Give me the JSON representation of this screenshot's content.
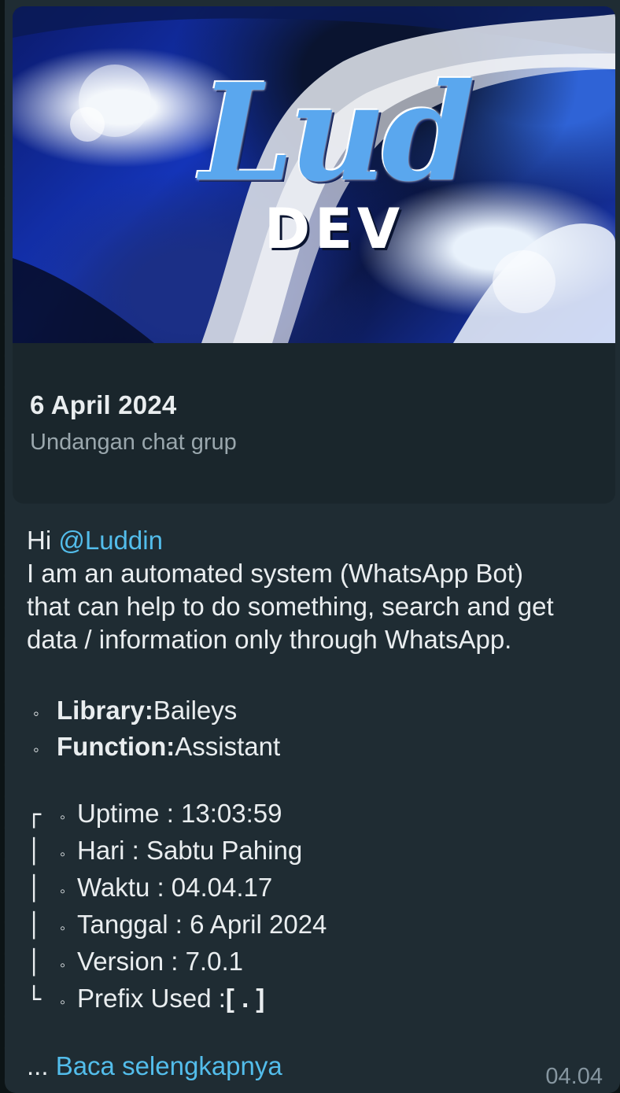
{
  "card": {
    "banner_text_main": "Lud",
    "banner_text_sub": "DEV",
    "title": "6 April 2024",
    "subtitle": "Undangan chat grup"
  },
  "message": {
    "greeting": "Hi ",
    "mention": "@Luddin",
    "intro_line1": "I am an automated system (WhatsApp Bot)",
    "intro_line2": "that can help to do something, search and get",
    "intro_line3": "data / information only through WhatsApp.",
    "bullets": [
      {
        "label": "Library:",
        "value": " Baileys"
      },
      {
        "label": "Function:",
        "value": " Assistant"
      }
    ],
    "frame_chars": [
      "┌",
      "│",
      "│",
      "│",
      "│",
      "└"
    ],
    "stats": [
      "Uptime : 13:03:59",
      "Hari : Sabtu Pahing",
      "Waktu : 04.04.17",
      "Tanggal : 6 April 2024",
      "Version : 7.0.1",
      "Prefix Used : "
    ],
    "prefix_value": "[ . ]",
    "ellipsis": "... ",
    "read_more": "Baca selengkapnya",
    "time": "04.04"
  },
  "icons": {
    "bullet": "white-circle-bullet"
  },
  "colors": {
    "bubble": "#1f2c33",
    "card": "#1a262c",
    "link": "#53bdeb",
    "secondary_text": "#9aa7ad",
    "timestamp": "#8696a0"
  }
}
